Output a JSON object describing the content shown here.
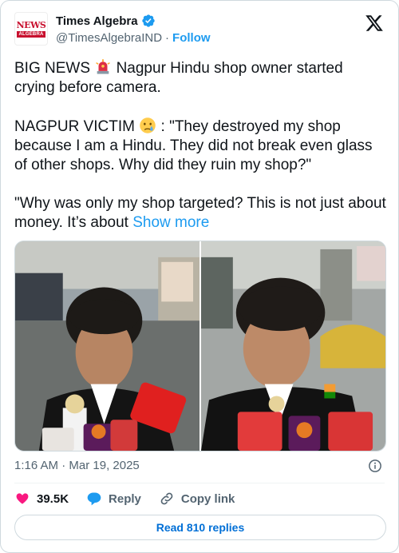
{
  "account": {
    "display_name": "Times Algebra",
    "handle": "@TimesAlgebraIND",
    "separator": "·",
    "follow_label": "Follow",
    "avatar_text_top": "NEWS",
    "avatar_text_bottom": "ALGEBRA"
  },
  "tweet": {
    "p1_before": "BIG NEWS ",
    "p1_after": " Nagpur Hindu shop owner started crying before camera.",
    "p2_before": "NAGPUR VICTIM ",
    "p2_after": " : \"They destroyed my shop because I am a Hindu. They did not break even glass of other shops. Why did they ruin my shop?\"",
    "p3": "\"Why was only my shop targeted? This is not just about money. It’s about ",
    "show_more": "Show more"
  },
  "media": {
    "left_badge": "SHARMA",
    "right_badge": "SHARMA",
    "mic_text_left": "आज तक",
    "mic_text_right": "आज तक"
  },
  "meta": {
    "time": "1:16 AM",
    "separator": "·",
    "date": "Mar 19, 2025"
  },
  "actions": {
    "likes": "39.5K",
    "reply_label": "Reply",
    "copy_label": "Copy link"
  },
  "footer": {
    "read_replies": "Read 810 replies"
  },
  "colors": {
    "accent": "#1d9bf0",
    "like": "#f91880",
    "verified": "#1d9bf0",
    "brand_red": "#c8102e"
  },
  "icons": {
    "verified": "verified-badge-icon",
    "x_logo": "x-logo-icon",
    "siren": "siren-emoji-icon",
    "crying": "crying-face-emoji-icon",
    "info": "info-icon",
    "heart": "heart-icon",
    "reply": "reply-bubble-icon",
    "link": "link-icon"
  }
}
